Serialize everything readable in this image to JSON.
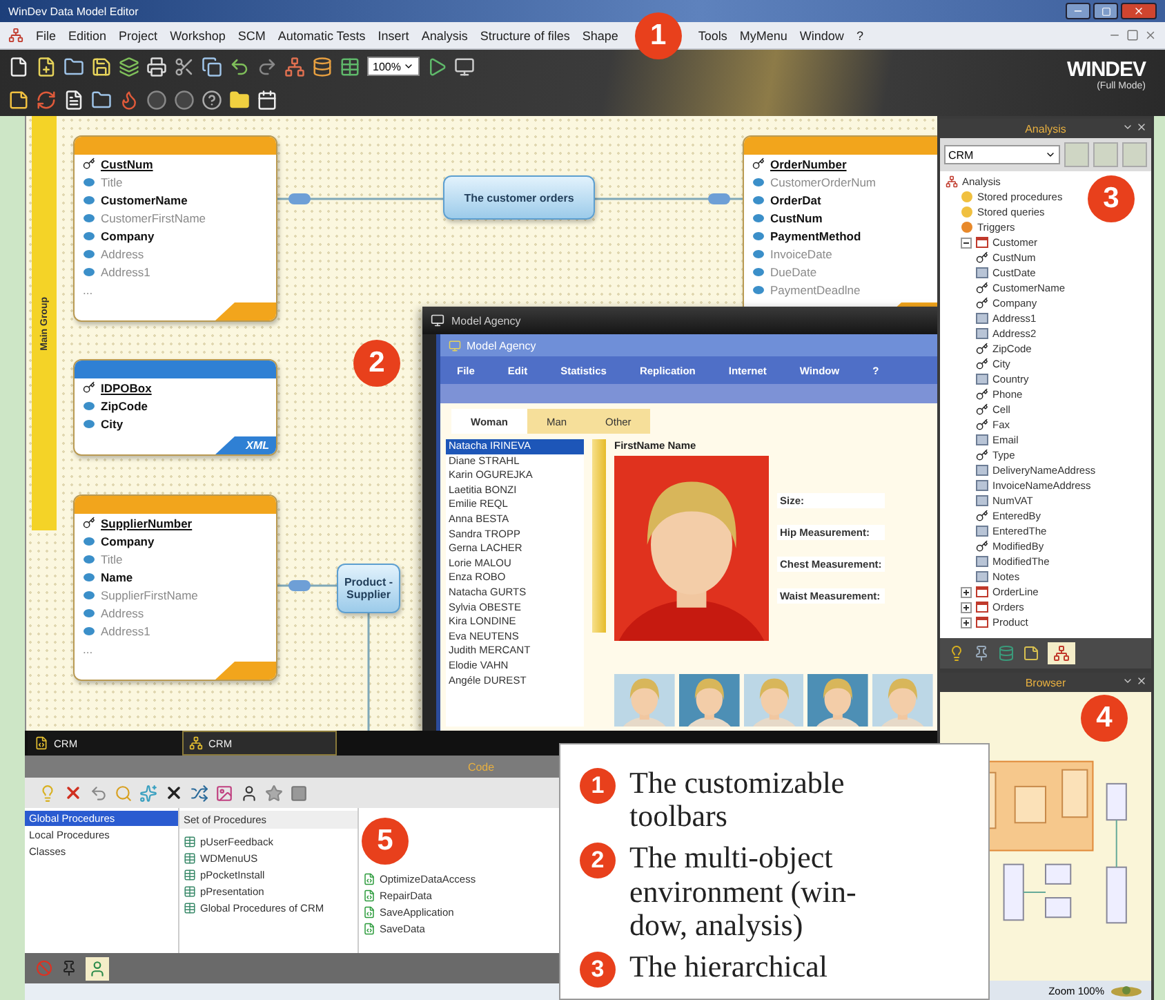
{
  "window": {
    "title": "WinDev Data Model Editor"
  },
  "menu": [
    "File",
    "Edition",
    "Project",
    "Workshop",
    "SCM",
    "Automatic Tests",
    "Insert",
    "Analysis",
    "Structure of files",
    "Shape",
    "Tools",
    "MyMenu",
    "Window",
    "?"
  ],
  "toolbar": {
    "zoom": "100%"
  },
  "logo": {
    "name": "WINDEV",
    "mode": "(Full Mode)"
  },
  "diagram": {
    "group_tab": "Main Group",
    "tables": [
      {
        "color": "#f2a51c",
        "fields": [
          {
            "name": "CustNum",
            "kind": "key"
          },
          {
            "name": "Title",
            "kind": "plain"
          },
          {
            "name": "CustomerName",
            "kind": "main"
          },
          {
            "name": "CustomerFirstName",
            "kind": "plain"
          },
          {
            "name": "Company",
            "kind": "main"
          },
          {
            "name": "Address",
            "kind": "plain"
          },
          {
            "name": "Address1",
            "kind": "plain"
          },
          {
            "name": "...",
            "kind": "more"
          }
        ]
      },
      {
        "color": "#2f80d4",
        "footer": "XML",
        "fields": [
          {
            "name": "IDPOBox",
            "kind": "key"
          },
          {
            "name": "ZipCode",
            "kind": "main"
          },
          {
            "name": "City",
            "kind": "main"
          }
        ]
      },
      {
        "color": "#f2a51c",
        "fields": [
          {
            "name": "SupplierNumber",
            "kind": "key"
          },
          {
            "name": "Company",
            "kind": "main"
          },
          {
            "name": "Title",
            "kind": "plain"
          },
          {
            "name": "Name",
            "kind": "main"
          },
          {
            "name": "SupplierFirstName",
            "kind": "plain"
          },
          {
            "name": "Address",
            "kind": "plain"
          },
          {
            "name": "Address1",
            "kind": "plain"
          },
          {
            "name": "...",
            "kind": "more"
          }
        ]
      },
      {
        "color": "#f2a51c",
        "fields": [
          {
            "name": "OrderNumber",
            "kind": "key"
          },
          {
            "name": "CustomerOrderNum",
            "kind": "plain"
          },
          {
            "name": "OrderDat",
            "kind": "main"
          },
          {
            "name": "CustNum",
            "kind": "main"
          },
          {
            "name": "PaymentMethod",
            "kind": "main"
          },
          {
            "name": "InvoiceDate",
            "kind": "plain"
          },
          {
            "name": "DueDate",
            "kind": "plain"
          },
          {
            "name": "PaymentDeadlne",
            "kind": "plain"
          }
        ]
      }
    ],
    "relations": [
      {
        "label": "The customer orders"
      },
      {
        "label": "Product - Supplier"
      }
    ]
  },
  "model_window": {
    "title": "Model Agency",
    "app_title": "Model Agency",
    "menu": [
      "File",
      "Edit",
      "Statistics",
      "Replication",
      "Internet",
      "Window",
      "?"
    ],
    "tabs": [
      {
        "label": "Woman",
        "selected": true
      },
      {
        "label": "Man",
        "selected": false
      },
      {
        "label": "Other",
        "selected": false
      }
    ],
    "list": [
      {
        "name": "Natacha IRINEVA",
        "selected": true
      },
      {
        "name": "Diane STRAHL",
        "selected": false
      },
      {
        "name": "Karin OGUREJKA",
        "selected": false
      },
      {
        "name": "Laetitia BONZI",
        "selected": false
      },
      {
        "name": "Emilie REQL",
        "selected": false
      },
      {
        "name": "Anna BESTA",
        "selected": false
      },
      {
        "name": "Sandra TROPP",
        "selected": false
      },
      {
        "name": "Gerna LACHER",
        "selected": false
      },
      {
        "name": "Lorie MALOU",
        "selected": false
      },
      {
        "name": "Enza ROBO",
        "selected": false
      },
      {
        "name": "Natacha GURTS",
        "selected": false
      },
      {
        "name": "Sylvia OBESTE",
        "selected": false
      },
      {
        "name": "Kira LONDINE",
        "selected": false
      },
      {
        "name": "Eva NEUTENS",
        "selected": false
      },
      {
        "name": "Judith MERCANT",
        "selected": false
      },
      {
        "name": "Elodie VAHN",
        "selected": false
      },
      {
        "name": "Angéle DUREST",
        "selected": false
      }
    ],
    "detail_label": "FirstName Name",
    "fields": [
      "Size:",
      "Hip Measurement:",
      "Chest Measurement:",
      "Waist Measurement:"
    ]
  },
  "analysis_panel": {
    "title": "Analysis",
    "selector": "CRM",
    "tree": {
      "label": "Analysis",
      "kind": "root",
      "children": [
        {
          "label": "Stored procedures",
          "kind": "folder"
        },
        {
          "label": "Stored queries",
          "kind": "folder"
        },
        {
          "label": "Triggers",
          "kind": "trigger"
        },
        {
          "label": "Customer",
          "kind": "table",
          "expanded": true,
          "children": [
            {
              "label": "CustNum",
              "kind": "key"
            },
            {
              "label": "CustDate",
              "kind": "field"
            },
            {
              "label": "CustomerName",
              "kind": "key"
            },
            {
              "label": "Company",
              "kind": "key"
            },
            {
              "label": "Address1",
              "kind": "field"
            },
            {
              "label": "Address2",
              "kind": "field"
            },
            {
              "label": "ZipCode",
              "kind": "key"
            },
            {
              "label": "City",
              "kind": "key"
            },
            {
              "label": "Country",
              "kind": "field"
            },
            {
              "label": "Phone",
              "kind": "key"
            },
            {
              "label": "Cell",
              "kind": "key"
            },
            {
              "label": "Fax",
              "kind": "key"
            },
            {
              "label": "Email",
              "kind": "field"
            },
            {
              "label": "Type",
              "kind": "key"
            },
            {
              "label": "DeliveryNameAddress",
              "kind": "field"
            },
            {
              "label": "InvoiceNameAddress",
              "kind": "field"
            },
            {
              "label": "NumVAT",
              "kind": "field"
            },
            {
              "label": "EnteredBy",
              "kind": "key"
            },
            {
              "label": "EnteredThe",
              "kind": "field"
            },
            {
              "label": "ModifiedBy",
              "kind": "key"
            },
            {
              "label": "ModifiedThe",
              "kind": "field"
            },
            {
              "label": "Notes",
              "kind": "field"
            }
          ]
        },
        {
          "label": "OrderLine",
          "kind": "table",
          "expanded": false
        },
        {
          "label": "Orders",
          "kind": "table",
          "expanded": false
        },
        {
          "label": "Product",
          "kind": "table",
          "expanded": false
        }
      ]
    }
  },
  "browser_panel": {
    "title": "Browser",
    "zoom": "Zoom 100%"
  },
  "doc_tabs": [
    {
      "label": "CRM",
      "selected": false
    },
    {
      "label": "CRM",
      "selected": true
    }
  ],
  "code_panel": {
    "title": "Code",
    "categories": [
      {
        "label": "Global Procedures",
        "selected": true
      },
      {
        "label": "Local Procedures",
        "selected": false
      },
      {
        "label": "Classes",
        "selected": false
      }
    ],
    "sets_header": "Set of Procedures",
    "sets": [
      "pUserFeedback",
      "WDMenuUS",
      "pPocketInstall",
      "pPresentation",
      "Global Procedures of CRM"
    ],
    "procedures": [
      "OptimizeDataAccess",
      "RepairData",
      "SaveApplication",
      "SaveData"
    ]
  },
  "callout_badges": [
    "1",
    "2",
    "3",
    "4",
    "5"
  ],
  "legend": [
    {
      "number": "1",
      "text": "The customizable toolbars"
    },
    {
      "number": "2",
      "text": "The multi-object environment (win-dow, analysis)"
    },
    {
      "number": "3",
      "text": "The hierarchical"
    }
  ]
}
